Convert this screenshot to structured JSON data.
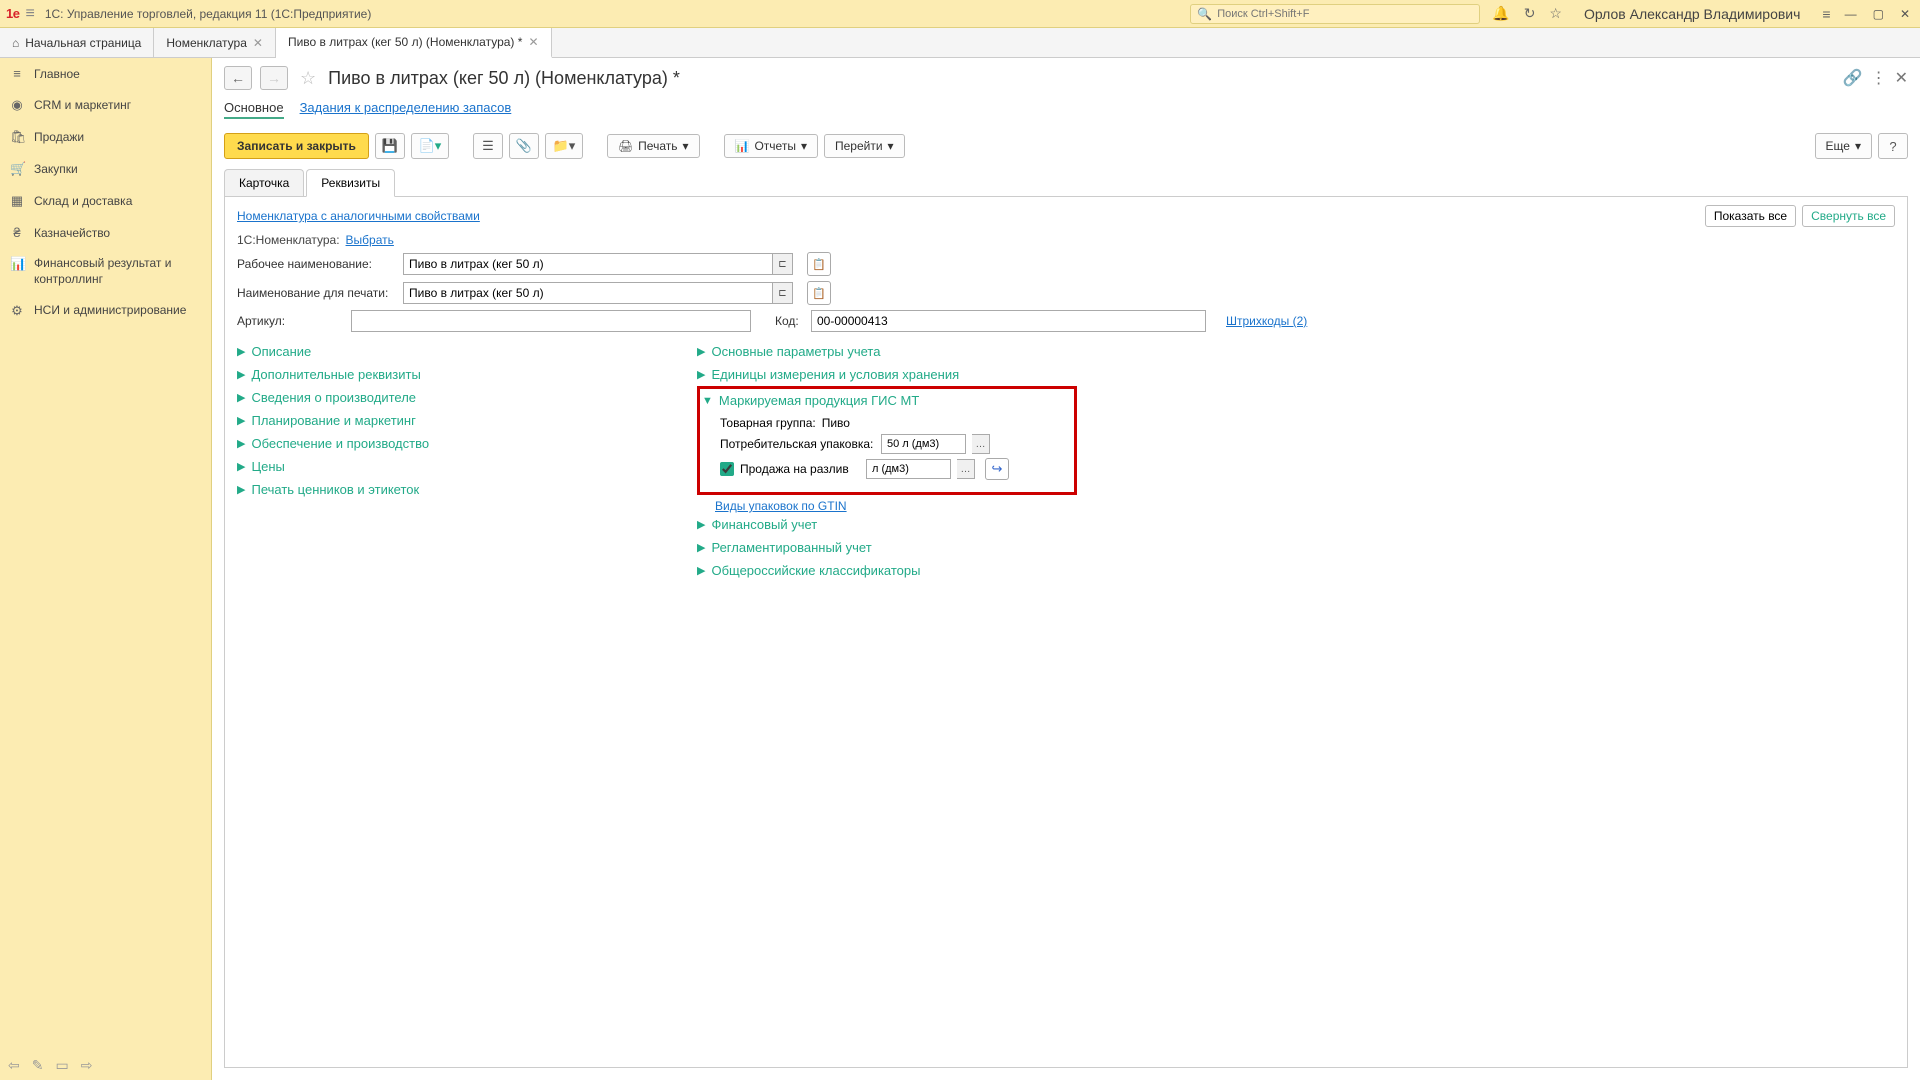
{
  "titlebar": {
    "app_title": "1С: Управление торговлей, редакция 11  (1С:Предприятие)",
    "search_placeholder": "Поиск Ctrl+Shift+F",
    "user": "Орлов Александр Владимирович"
  },
  "tabs": {
    "home": "Начальная страница",
    "t1": "Номенклатура",
    "t2": "Пиво в литрах (кег 50 л) (Номенклатура) *"
  },
  "sidebar": [
    {
      "icon": "≡",
      "label": "Главное"
    },
    {
      "icon": "◉",
      "label": "CRM и маркетинг"
    },
    {
      "icon": "🛍",
      "label": "Продажи"
    },
    {
      "icon": "🛒",
      "label": "Закупки"
    },
    {
      "icon": "▦",
      "label": "Склад и доставка"
    },
    {
      "icon": "₴",
      "label": "Казначейство"
    },
    {
      "icon": "📊",
      "label": "Финансовый результат и контроллинг"
    },
    {
      "icon": "⚙",
      "label": "НСИ и администрирование"
    }
  ],
  "page": {
    "title": "Пиво в литрах (кег 50 л) (Номенклатура) *",
    "subtab_main": "Основное",
    "subtab_link": "Задания к распределению запасов"
  },
  "toolbar": {
    "save_close": "Записать и закрыть",
    "print": "Печать",
    "reports": "Отчеты",
    "goto": "Перейти",
    "more": "Еще",
    "help": "?"
  },
  "subtabs2": {
    "card": "Карточка",
    "requisites": "Реквизиты"
  },
  "details": {
    "similar_link": "Номенклатура с аналогичными свойствами",
    "show_all": "Показать все",
    "collapse_all": "Свернуть все",
    "nomen_1c_label": "1С:Номенклатура:",
    "nomen_1c_pick": "Выбрать",
    "work_name_label": "Рабочее наименование:",
    "work_name_value": "Пиво в литрах (кег 50 л)",
    "print_name_label": "Наименование для печати:",
    "print_name_value": "Пиво в литрах (кег 50 л)",
    "article_label": "Артикул:",
    "article_value": "",
    "code_label": "Код:",
    "code_value": "00-00000413",
    "barcodes_link": "Штрихкоды (2)"
  },
  "left_groups": [
    "Описание",
    "Дополнительные реквизиты",
    "Сведения о производителе",
    "Планирование и маркетинг",
    "Обеспечение и производство",
    "Цены",
    "Печать ценников и этикеток"
  ],
  "right_groups": {
    "g1": "Основные параметры учета",
    "g2": "Единицы измерения и условия хранения",
    "marking": {
      "title": "Маркируемая продукция ГИС МТ",
      "goods_group_label": "Товарная группа:",
      "goods_group_value": "Пиво",
      "consumer_pack_label": "Потребительская упаковка:",
      "consumer_pack_value": "50 л (дм3)",
      "on_tap_label": "Продажа на разлив",
      "on_tap_value": "л (дм3)",
      "gtin_link": "Виды упаковок по GTIN"
    },
    "g4": "Финансовый учет",
    "g5": "Регламентированный учет",
    "g6": "Общероссийские классификаторы"
  }
}
